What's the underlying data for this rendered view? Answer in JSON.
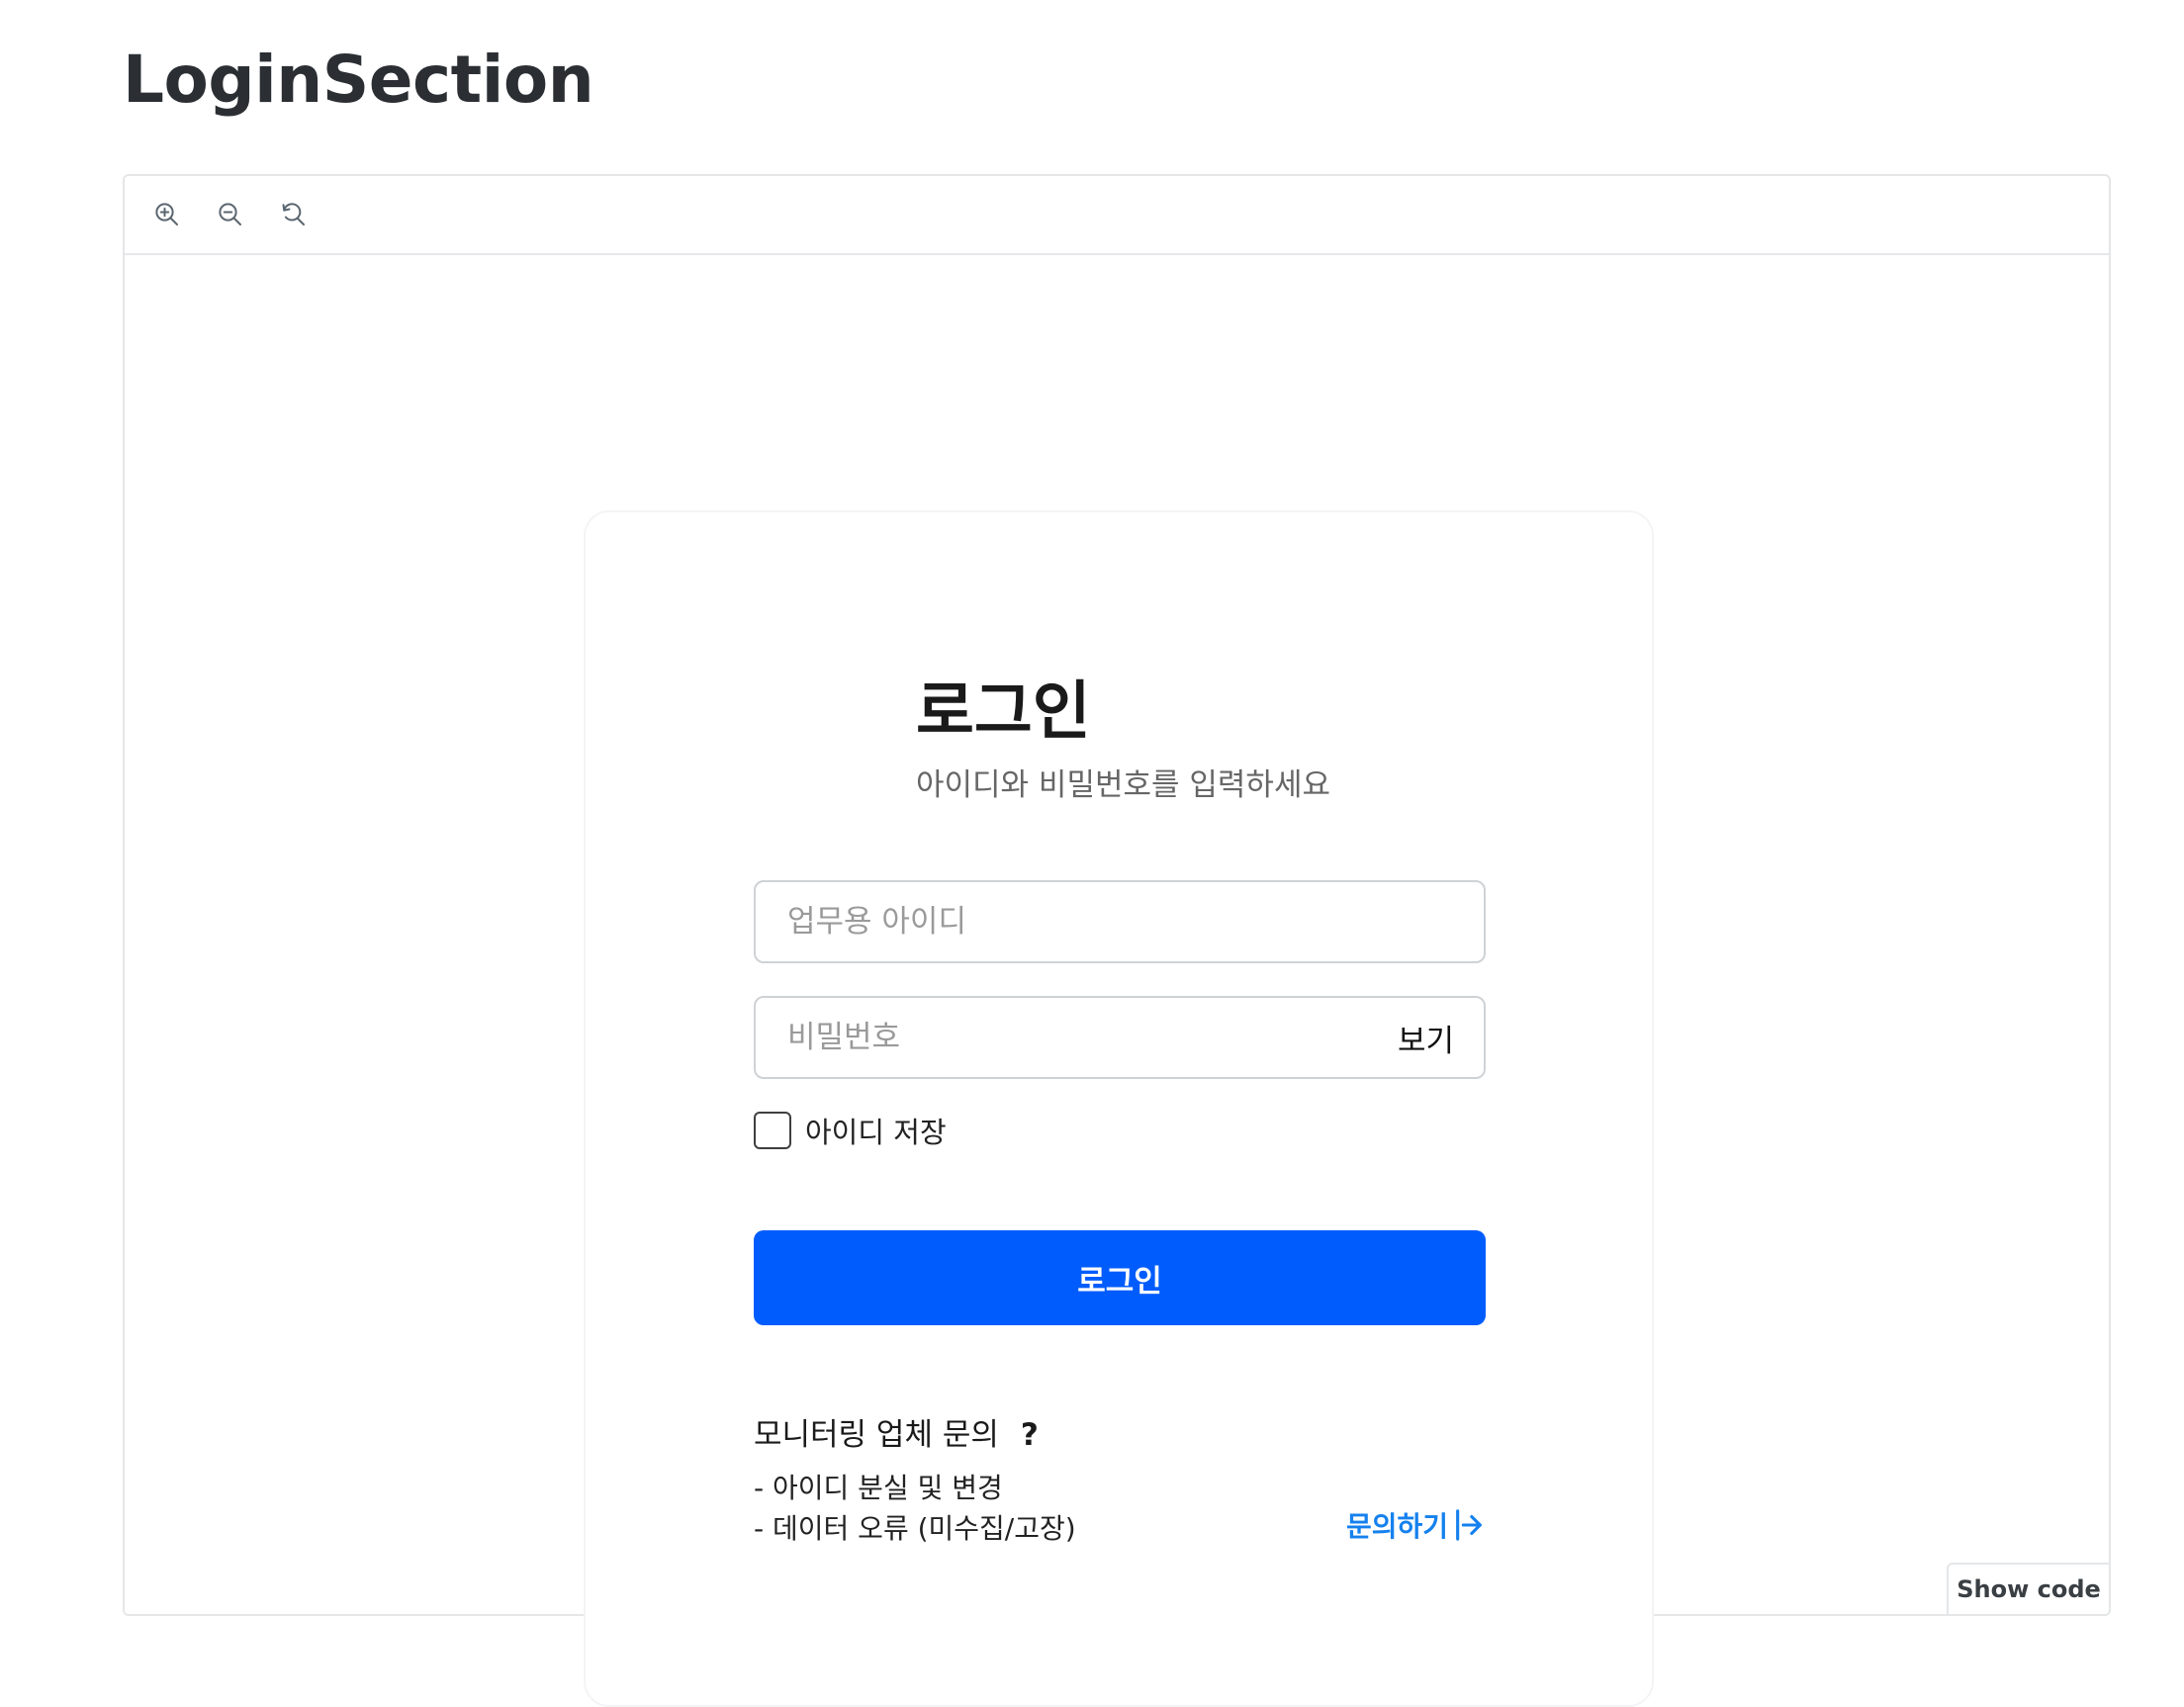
{
  "page": {
    "title": "LoginSection"
  },
  "toolbar": {
    "zoom_in_icon": "zoom-in-icon",
    "zoom_out_icon": "zoom-out-icon",
    "reset_icon": "reset-zoom-icon"
  },
  "login": {
    "title": "로그인",
    "subtitle": "아이디와 비밀번호를 입력하세요",
    "id_placeholder": "업무용 아이디",
    "id_value": "",
    "password_placeholder": "비밀번호",
    "password_value": "",
    "show_password_label": "보기",
    "remember_label": "아이디 저장",
    "remember_checked": false,
    "submit_label": "로그인"
  },
  "help": {
    "title": "모니터링 업체 문의",
    "title_mark": "?",
    "lines": [
      "- 아이디 분실 및 변경",
      "- 데이터 오류 (미수집/고장)"
    ],
    "link_label": "문의하기"
  },
  "footer": {
    "show_code_label": "Show code"
  },
  "colors": {
    "primary": "#005cfd",
    "link": "#1581ee",
    "border": "#cfd2d5",
    "placeholder": "#9a9a9a"
  }
}
